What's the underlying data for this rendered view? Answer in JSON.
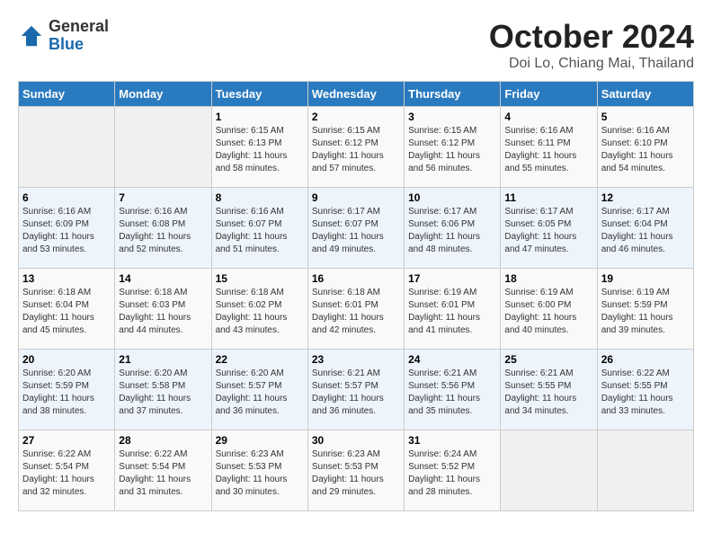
{
  "logo": {
    "general": "General",
    "blue": "Blue"
  },
  "title": "October 2024",
  "location": "Doi Lo, Chiang Mai, Thailand",
  "weekdays": [
    "Sunday",
    "Monday",
    "Tuesday",
    "Wednesday",
    "Thursday",
    "Friday",
    "Saturday"
  ],
  "weeks": [
    [
      {
        "day": "",
        "sunrise": "",
        "sunset": "",
        "daylight": ""
      },
      {
        "day": "",
        "sunrise": "",
        "sunset": "",
        "daylight": ""
      },
      {
        "day": "1",
        "sunrise": "Sunrise: 6:15 AM",
        "sunset": "Sunset: 6:13 PM",
        "daylight": "Daylight: 11 hours and 58 minutes."
      },
      {
        "day": "2",
        "sunrise": "Sunrise: 6:15 AM",
        "sunset": "Sunset: 6:12 PM",
        "daylight": "Daylight: 11 hours and 57 minutes."
      },
      {
        "day": "3",
        "sunrise": "Sunrise: 6:15 AM",
        "sunset": "Sunset: 6:12 PM",
        "daylight": "Daylight: 11 hours and 56 minutes."
      },
      {
        "day": "4",
        "sunrise": "Sunrise: 6:16 AM",
        "sunset": "Sunset: 6:11 PM",
        "daylight": "Daylight: 11 hours and 55 minutes."
      },
      {
        "day": "5",
        "sunrise": "Sunrise: 6:16 AM",
        "sunset": "Sunset: 6:10 PM",
        "daylight": "Daylight: 11 hours and 54 minutes."
      }
    ],
    [
      {
        "day": "6",
        "sunrise": "Sunrise: 6:16 AM",
        "sunset": "Sunset: 6:09 PM",
        "daylight": "Daylight: 11 hours and 53 minutes."
      },
      {
        "day": "7",
        "sunrise": "Sunrise: 6:16 AM",
        "sunset": "Sunset: 6:08 PM",
        "daylight": "Daylight: 11 hours and 52 minutes."
      },
      {
        "day": "8",
        "sunrise": "Sunrise: 6:16 AM",
        "sunset": "Sunset: 6:07 PM",
        "daylight": "Daylight: 11 hours and 51 minutes."
      },
      {
        "day": "9",
        "sunrise": "Sunrise: 6:17 AM",
        "sunset": "Sunset: 6:07 PM",
        "daylight": "Daylight: 11 hours and 49 minutes."
      },
      {
        "day": "10",
        "sunrise": "Sunrise: 6:17 AM",
        "sunset": "Sunset: 6:06 PM",
        "daylight": "Daylight: 11 hours and 48 minutes."
      },
      {
        "day": "11",
        "sunrise": "Sunrise: 6:17 AM",
        "sunset": "Sunset: 6:05 PM",
        "daylight": "Daylight: 11 hours and 47 minutes."
      },
      {
        "day": "12",
        "sunrise": "Sunrise: 6:17 AM",
        "sunset": "Sunset: 6:04 PM",
        "daylight": "Daylight: 11 hours and 46 minutes."
      }
    ],
    [
      {
        "day": "13",
        "sunrise": "Sunrise: 6:18 AM",
        "sunset": "Sunset: 6:04 PM",
        "daylight": "Daylight: 11 hours and 45 minutes."
      },
      {
        "day": "14",
        "sunrise": "Sunrise: 6:18 AM",
        "sunset": "Sunset: 6:03 PM",
        "daylight": "Daylight: 11 hours and 44 minutes."
      },
      {
        "day": "15",
        "sunrise": "Sunrise: 6:18 AM",
        "sunset": "Sunset: 6:02 PM",
        "daylight": "Daylight: 11 hours and 43 minutes."
      },
      {
        "day": "16",
        "sunrise": "Sunrise: 6:18 AM",
        "sunset": "Sunset: 6:01 PM",
        "daylight": "Daylight: 11 hours and 42 minutes."
      },
      {
        "day": "17",
        "sunrise": "Sunrise: 6:19 AM",
        "sunset": "Sunset: 6:01 PM",
        "daylight": "Daylight: 11 hours and 41 minutes."
      },
      {
        "day": "18",
        "sunrise": "Sunrise: 6:19 AM",
        "sunset": "Sunset: 6:00 PM",
        "daylight": "Daylight: 11 hours and 40 minutes."
      },
      {
        "day": "19",
        "sunrise": "Sunrise: 6:19 AM",
        "sunset": "Sunset: 5:59 PM",
        "daylight": "Daylight: 11 hours and 39 minutes."
      }
    ],
    [
      {
        "day": "20",
        "sunrise": "Sunrise: 6:20 AM",
        "sunset": "Sunset: 5:59 PM",
        "daylight": "Daylight: 11 hours and 38 minutes."
      },
      {
        "day": "21",
        "sunrise": "Sunrise: 6:20 AM",
        "sunset": "Sunset: 5:58 PM",
        "daylight": "Daylight: 11 hours and 37 minutes."
      },
      {
        "day": "22",
        "sunrise": "Sunrise: 6:20 AM",
        "sunset": "Sunset: 5:57 PM",
        "daylight": "Daylight: 11 hours and 36 minutes."
      },
      {
        "day": "23",
        "sunrise": "Sunrise: 6:21 AM",
        "sunset": "Sunset: 5:57 PM",
        "daylight": "Daylight: 11 hours and 36 minutes."
      },
      {
        "day": "24",
        "sunrise": "Sunrise: 6:21 AM",
        "sunset": "Sunset: 5:56 PM",
        "daylight": "Daylight: 11 hours and 35 minutes."
      },
      {
        "day": "25",
        "sunrise": "Sunrise: 6:21 AM",
        "sunset": "Sunset: 5:55 PM",
        "daylight": "Daylight: 11 hours and 34 minutes."
      },
      {
        "day": "26",
        "sunrise": "Sunrise: 6:22 AM",
        "sunset": "Sunset: 5:55 PM",
        "daylight": "Daylight: 11 hours and 33 minutes."
      }
    ],
    [
      {
        "day": "27",
        "sunrise": "Sunrise: 6:22 AM",
        "sunset": "Sunset: 5:54 PM",
        "daylight": "Daylight: 11 hours and 32 minutes."
      },
      {
        "day": "28",
        "sunrise": "Sunrise: 6:22 AM",
        "sunset": "Sunset: 5:54 PM",
        "daylight": "Daylight: 11 hours and 31 minutes."
      },
      {
        "day": "29",
        "sunrise": "Sunrise: 6:23 AM",
        "sunset": "Sunset: 5:53 PM",
        "daylight": "Daylight: 11 hours and 30 minutes."
      },
      {
        "day": "30",
        "sunrise": "Sunrise: 6:23 AM",
        "sunset": "Sunset: 5:53 PM",
        "daylight": "Daylight: 11 hours and 29 minutes."
      },
      {
        "day": "31",
        "sunrise": "Sunrise: 6:24 AM",
        "sunset": "Sunset: 5:52 PM",
        "daylight": "Daylight: 11 hours and 28 minutes."
      },
      {
        "day": "",
        "sunrise": "",
        "sunset": "",
        "daylight": ""
      },
      {
        "day": "",
        "sunrise": "",
        "sunset": "",
        "daylight": ""
      }
    ]
  ]
}
